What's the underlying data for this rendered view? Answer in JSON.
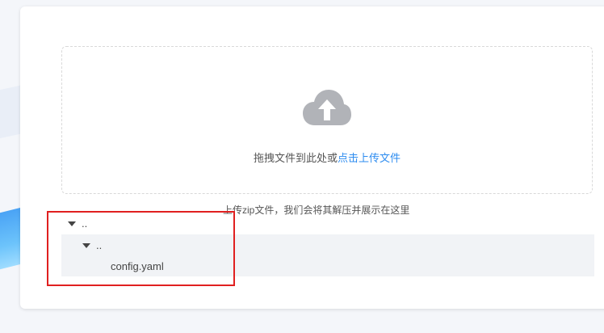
{
  "upload": {
    "drag_text": "拖拽文件到此处或",
    "click_text": "点击上传文件",
    "hint": "上传zip文件，我们会将其解压并展示在这里",
    "icon": "cloud-upload-icon"
  },
  "tree": {
    "items": [
      {
        "label": "..",
        "expanded": true,
        "depth": 0
      },
      {
        "label": "..",
        "expanded": true,
        "depth": 1
      },
      {
        "label": "config.yaml",
        "depth": 2
      }
    ]
  },
  "colors": {
    "link": "#2d8cf0",
    "highlight_border": "#e02020",
    "icon": "#b1b3b8"
  }
}
